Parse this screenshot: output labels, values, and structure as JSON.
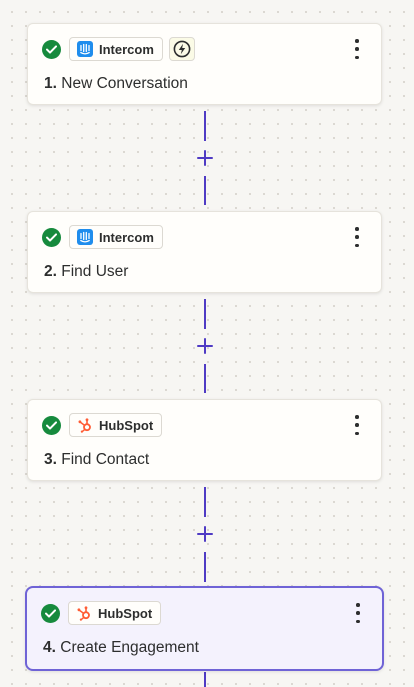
{
  "steps": [
    {
      "number": "1.",
      "title": "New Conversation",
      "app": "Intercom",
      "app_icon": "intercom-logo-icon",
      "status": "complete",
      "trigger": true,
      "active": false
    },
    {
      "number": "2.",
      "title": "Find User",
      "app": "Intercom",
      "app_icon": "intercom-logo-icon",
      "status": "complete",
      "trigger": false,
      "active": false
    },
    {
      "number": "3.",
      "title": "Find Contact",
      "app": "HubSpot",
      "app_icon": "hubspot-logo-icon",
      "status": "complete",
      "trigger": false,
      "active": false
    },
    {
      "number": "4.",
      "title": "Create Engagement",
      "app": "HubSpot",
      "app_icon": "hubspot-logo-icon",
      "status": "complete",
      "trigger": false,
      "active": true
    }
  ],
  "icons": {
    "status": "check-circle-icon",
    "trigger": "lightning-bolt-icon",
    "menu": "more-vertical-icon",
    "add": "plus-icon"
  },
  "colors": {
    "canvas": "#f7f6f3",
    "connector": "#4f3bc4",
    "success": "#168a3d",
    "selected_border": "#6f63d6",
    "intercom": "#1f8ded",
    "hubspot": "#ff5c35"
  }
}
